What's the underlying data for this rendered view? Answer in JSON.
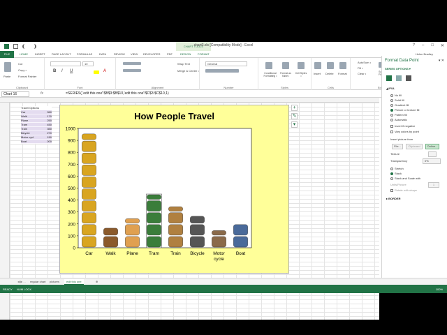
{
  "window": {
    "title": "chart3.xls [Compatibility Mode] - Excel",
    "context_tools": "CHART TOOLS",
    "user": "Helen Bradley"
  },
  "tabs": [
    "FILE",
    "HOME",
    "INSERT",
    "PAGE LAYOUT",
    "FORMULAS",
    "DATA",
    "REVIEW",
    "VIEW",
    "DEVELOPER",
    "PDF",
    "DESIGN",
    "FORMAT"
  ],
  "ribbon": {
    "clipboard": {
      "label": "Clipboard",
      "paste": "Paste",
      "cut": "Cut",
      "copy": "Copy •",
      "painter": "Format Painter"
    },
    "font": {
      "label": "Font",
      "size": "10"
    },
    "alignment": {
      "label": "Alignment",
      "wrap": "Wrap Text",
      "merge": "Merge & Center •"
    },
    "number": {
      "label": "Number",
      "format": "General"
    },
    "styles": {
      "label": "Styles",
      "conditional": "Conditional Formatting •",
      "format_table": "Format as Table •",
      "cell_styles": "Cell Styles •"
    },
    "cells": {
      "label": "Cells",
      "insert": "Insert",
      "delete": "Delete",
      "format": "Format"
    },
    "editing": {
      "label": "Editing",
      "autosum": "AutoSum •",
      "fill": "Fill •",
      "clear": "Clear •",
      "sort": "Sort & Filter •",
      "find": "Find & Select •"
    }
  },
  "formula_bar": {
    "name_box": "Chart 16",
    "fx": "fx",
    "formula": "=SERIES(,'edit this one'!$B$3:$B$10,'edit this one'!$C$3:$C$10,1)"
  },
  "table": {
    "header": "Travel Options",
    "rows": [
      {
        "name": "Car",
        "value": "960"
      },
      {
        "name": "Walk",
        "value": "170"
      },
      {
        "name": "Plane",
        "value": "250"
      },
      {
        "name": "Tram",
        "value": "450"
      },
      {
        "name": "Train",
        "value": "350"
      },
      {
        "name": "Bicycle",
        "value": "270"
      },
      {
        "name": "Motor cycl",
        "value": "150"
      },
      {
        "name": "Boat",
        "value": "200"
      }
    ]
  },
  "chart_data": {
    "type": "bar",
    "title": "How People Travel",
    "categories": [
      "Car",
      "Walk",
      "Plane",
      "Tram",
      "Train",
      "Bicycle",
      "Motor\ncycle",
      "Boat"
    ],
    "values": [
      960,
      170,
      250,
      450,
      350,
      270,
      150,
      200
    ],
    "ylim": [
      0,
      1000
    ],
    "yticks": [
      "0",
      "100",
      "200",
      "300",
      "400",
      "500",
      "600",
      "700",
      "800",
      "900",
      "1000"
    ],
    "grid": false,
    "legend": "none"
  },
  "pane": {
    "title": "Format Data Point",
    "sub": "SERIES OPTIONS ▾",
    "fill": "◢ FILL",
    "options": [
      "No fill",
      "Solid fill",
      "Gradient fill",
      "Picture or texture fill",
      "Pattern fill",
      "Automatic"
    ],
    "checks": [
      "Invert if negative",
      "Vary colors by point"
    ],
    "insert_from": "Insert picture from",
    "file_btn": "File...",
    "clipboard_btn": "Clipboard",
    "online_btn": "Online...",
    "texture": "Texture",
    "transparency": "Transparency",
    "transparency_val": "0%",
    "stretch": "Stretch",
    "stack": "Stack",
    "stack_scale": "Stack and Scale with",
    "units": "Units/Picture",
    "units_val": "1",
    "rotate": "Rotate with shape",
    "border": "▸ BORDER"
  },
  "sheets": [
    "regular chart",
    "pictures",
    "edit this one"
  ],
  "status": {
    "ready": "READY",
    "numlock": "NUM LOCK",
    "zoom": "100%"
  }
}
